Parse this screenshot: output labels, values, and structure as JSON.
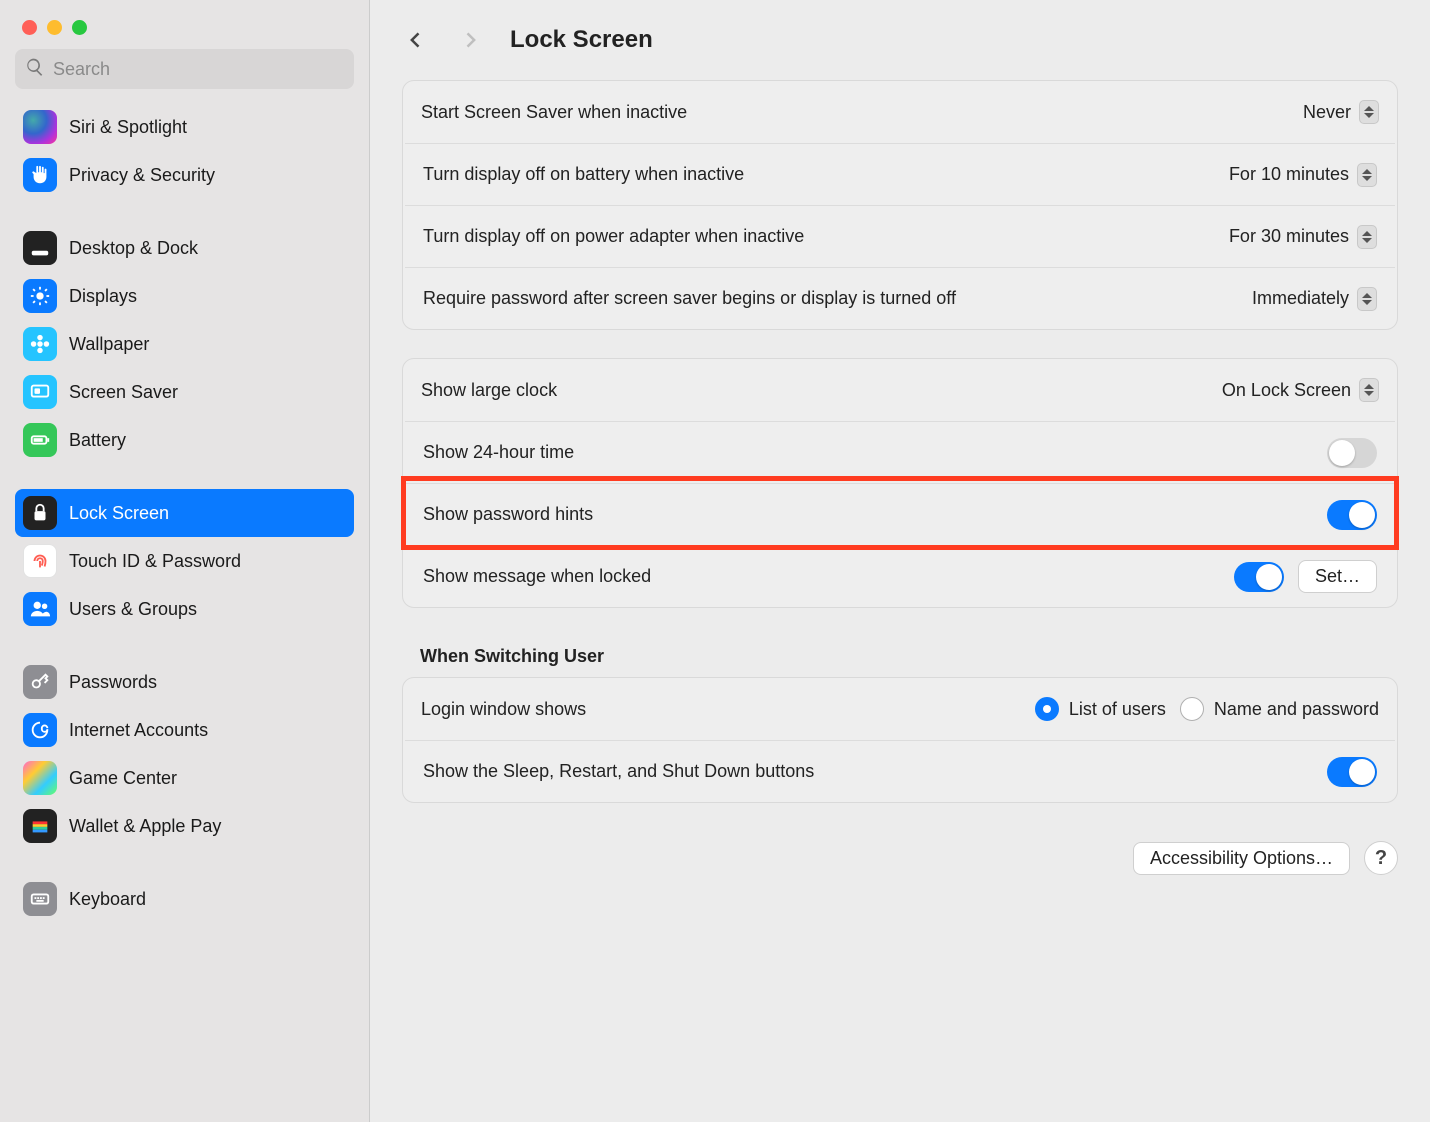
{
  "window": {
    "title": "Lock Screen"
  },
  "search": {
    "placeholder": "Search"
  },
  "sidebar": {
    "items": [
      {
        "label": "Siri & Spotlight",
        "icon": "siri-icon",
        "bg": "bg-grad-siri"
      },
      {
        "label": "Privacy & Security",
        "icon": "hand-icon",
        "bg": "bg-blue"
      },
      {
        "label": "Desktop & Dock",
        "icon": "dock-icon",
        "bg": "bg-dark"
      },
      {
        "label": "Displays",
        "icon": "sun-icon",
        "bg": "bg-blue"
      },
      {
        "label": "Wallpaper",
        "icon": "flower-icon",
        "bg": "bg-cyan"
      },
      {
        "label": "Screen Saver",
        "icon": "screensaver-icon",
        "bg": "bg-cyan"
      },
      {
        "label": "Battery",
        "icon": "battery-icon",
        "bg": "bg-green"
      },
      {
        "label": "Lock Screen",
        "icon": "lock-icon",
        "bg": "bg-dark",
        "selected": true
      },
      {
        "label": "Touch ID & Password",
        "icon": "fingerprint-icon",
        "bg": "bg-red"
      },
      {
        "label": "Users & Groups",
        "icon": "users-icon",
        "bg": "bg-blue"
      },
      {
        "label": "Passwords",
        "icon": "key-icon",
        "bg": "bg-grey"
      },
      {
        "label": "Internet Accounts",
        "icon": "at-icon",
        "bg": "bg-blue"
      },
      {
        "label": "Game Center",
        "icon": "gamecenter-icon",
        "bg": "bg-gc"
      },
      {
        "label": "Wallet & Apple Pay",
        "icon": "wallet-icon",
        "bg": "bg-wallet"
      },
      {
        "label": "Keyboard",
        "icon": "keyboard-icon",
        "bg": "bg-grey"
      }
    ]
  },
  "group1": {
    "r0": {
      "label": "Start Screen Saver when inactive",
      "value": "Never"
    },
    "r1": {
      "label": "Turn display off on battery when inactive",
      "value": "For 10 minutes"
    },
    "r2": {
      "label": "Turn display off on power adapter when inactive",
      "value": "For 30 minutes"
    },
    "r3": {
      "label": "Require password after screen saver begins or display is turned off",
      "value": "Immediately"
    }
  },
  "group2": {
    "r0": {
      "label": "Show large clock",
      "value": "On Lock Screen"
    },
    "r1": {
      "label": "Show 24-hour time",
      "on": false
    },
    "r2": {
      "label": "Show password hints",
      "on": true,
      "highlighted": true
    },
    "r3": {
      "label": "Show message when locked",
      "on": true,
      "button": "Set…"
    }
  },
  "switching": {
    "heading": "When Switching User",
    "r0": {
      "label": "Login window shows",
      "opt1": "List of users",
      "opt2": "Name and password",
      "selected": 1
    },
    "r1": {
      "label": "Show the Sleep, Restart, and Shut Down buttons",
      "on": true
    }
  },
  "footer": {
    "accessibility": "Accessibility Options…",
    "help": "?"
  }
}
